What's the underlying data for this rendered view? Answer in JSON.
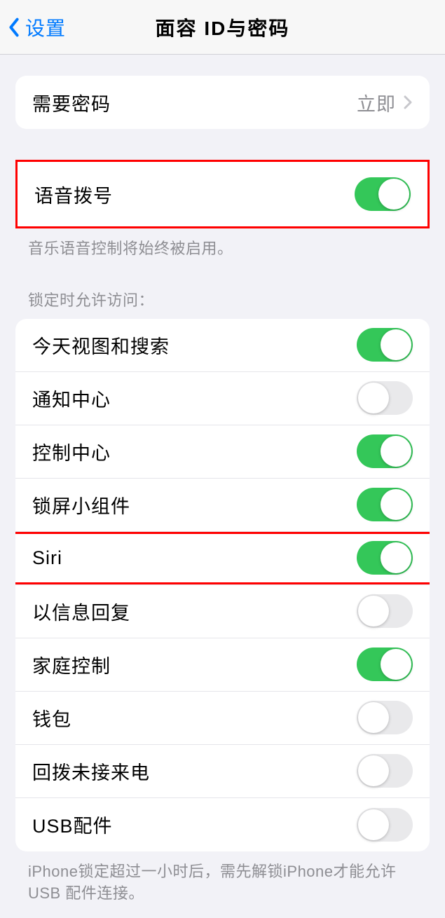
{
  "nav": {
    "back_label": "设置",
    "title": "面容 ID与密码"
  },
  "passcode": {
    "label": "需要密码",
    "value": "立即"
  },
  "voice_dial": {
    "label": "语音拨号",
    "footer": "音乐语音控制将始终被启用。"
  },
  "lock_access": {
    "header": "锁定时允许访问：",
    "items": [
      {
        "label": "今天视图和搜索",
        "on": true
      },
      {
        "label": "通知中心",
        "on": false
      },
      {
        "label": "控制中心",
        "on": true
      },
      {
        "label": "锁屏小组件",
        "on": true
      },
      {
        "label": "Siri",
        "on": true
      },
      {
        "label": "以信息回复",
        "on": false
      },
      {
        "label": "家庭控制",
        "on": true
      },
      {
        "label": "钱包",
        "on": false
      },
      {
        "label": "回拨未接来电",
        "on": false
      },
      {
        "label": "USB配件",
        "on": false
      }
    ],
    "footer": "iPhone锁定超过一小时后，需先解锁iPhone才能允许USB 配件连接。"
  }
}
